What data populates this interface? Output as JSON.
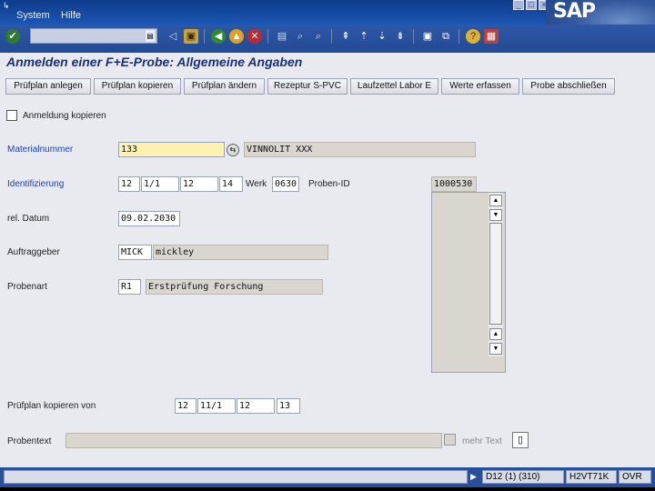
{
  "menu": {
    "items": [
      "System",
      "Hilfe"
    ]
  },
  "window_buttons": [
    "_",
    "□",
    "×"
  ],
  "brand": "SAP",
  "toolbar": {
    "command_field_value": "",
    "icons": [
      "enter-icon",
      "save-icon",
      "back-icon",
      "exit-icon",
      "cancel-icon",
      "print-icon",
      "find-icon",
      "find-next-icon",
      "first-page-icon",
      "prev-page-icon",
      "next-page-icon",
      "last-page-icon",
      "new-session-icon",
      "shortcut-icon",
      "help-icon",
      "layout-icon"
    ]
  },
  "screen_title": "Anmelden einer F+E-Probe: Allgemeine Angaben",
  "app_buttons": [
    "Prüfplan anlegen",
    "Prüfplan kopieren",
    "Prüfplan ändern",
    "Rezeptur S-PVC",
    "Laufzettel Labor E",
    "Werte erfassen",
    "Probe abschließen"
  ],
  "form": {
    "copy_checkbox_label": "Anmeldung kopieren",
    "material_label": "Materialnummer",
    "material_value": "133",
    "material_desc": "VINNOLIT  XXX",
    "ident_label": "Identifizierung",
    "ident_values": [
      "12",
      "1/1",
      "12",
      "14"
    ],
    "werk_label": "Werk",
    "werk_value": "0630",
    "proben_id_label": "Proben-ID",
    "proben_id_value": "1000530",
    "rel_datum_label": "rel. Datum",
    "rel_datum_value": "09.02.2030",
    "auftraggeber_label": "Auftraggeber",
    "auftraggeber_code": "MICK",
    "auftraggeber_name": "mickley",
    "probenart_label": "Probenart",
    "probenart_code": "R1",
    "probenart_desc": "Erstprüfung Forschung",
    "pruefplan_kopieren_label": "Prüfplan kopieren von",
    "pruefplan_values": [
      "12",
      "11/1",
      "12",
      "13"
    ],
    "probentext_label": "Probentext",
    "probentext_value": "",
    "mehr_text_label": "mehr Text"
  },
  "status": {
    "message": "",
    "system": "D12 (1) (310)",
    "server": "H2VT71K",
    "mode": "OVR"
  }
}
